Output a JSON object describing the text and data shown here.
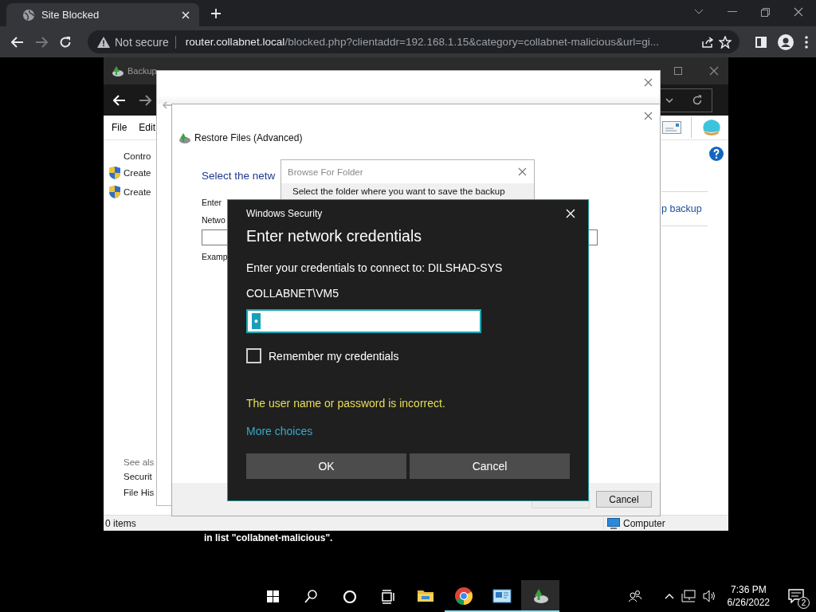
{
  "browser": {
    "tab": {
      "title": "Site Blocked"
    },
    "omnibox": {
      "security": "Not secure",
      "host": "router.collabnet.local",
      "path": "/blocked.php?clientaddr=192.168.1.15&category=collabnet-malicious&url=gi..."
    }
  },
  "page_text": "in list \"collabnet-malicious\".",
  "backup_window": {
    "title": "Backup",
    "menu": [
      "File",
      "Edit"
    ],
    "sidebar": [
      {
        "kind": "text",
        "label": "Contro"
      },
      {
        "kind": "shield",
        "label": "Create"
      },
      {
        "kind": "shield",
        "label": "Create"
      }
    ],
    "see_also": {
      "heading": "See als",
      "items": [
        "Securit",
        "File His"
      ]
    },
    "link": "p backup",
    "status": "0 items",
    "location": "Computer"
  },
  "restore_dialog": {
    "title": "Restore Files (Advanced)",
    "heading": "Select the netw",
    "labels": [
      "Enter",
      "Netwo"
    ],
    "example": "Examp",
    "cancel": "Cancel"
  },
  "browse_dialog": {
    "title": "Browse For Folder",
    "prompt": "Select the folder where you want to save the backup"
  },
  "security_dialog": {
    "caption": "Windows Security",
    "heading": "Enter network credentials",
    "prompt": "Enter your credentials to connect to: DILSHAD-SYS",
    "user": "COLLABNET\\VM5",
    "password": {
      "value": "•",
      "selected": true
    },
    "remember": {
      "label": "Remember my credentials",
      "checked": false
    },
    "error": "The user name or password is incorrect.",
    "more": "More choices",
    "buttons": [
      "OK",
      "Cancel"
    ]
  },
  "taskbar": {
    "apps": [
      {
        "kind": "explorer",
        "running": false,
        "selected": false
      },
      {
        "kind": "chrome",
        "running": true,
        "selected": false
      },
      {
        "kind": "control-panel",
        "running": true,
        "selected": false
      },
      {
        "kind": "backup",
        "running": true,
        "selected": true
      }
    ],
    "clock": {
      "time": "7:36 PM",
      "date": "6/26/2022"
    },
    "notifications": "2"
  }
}
